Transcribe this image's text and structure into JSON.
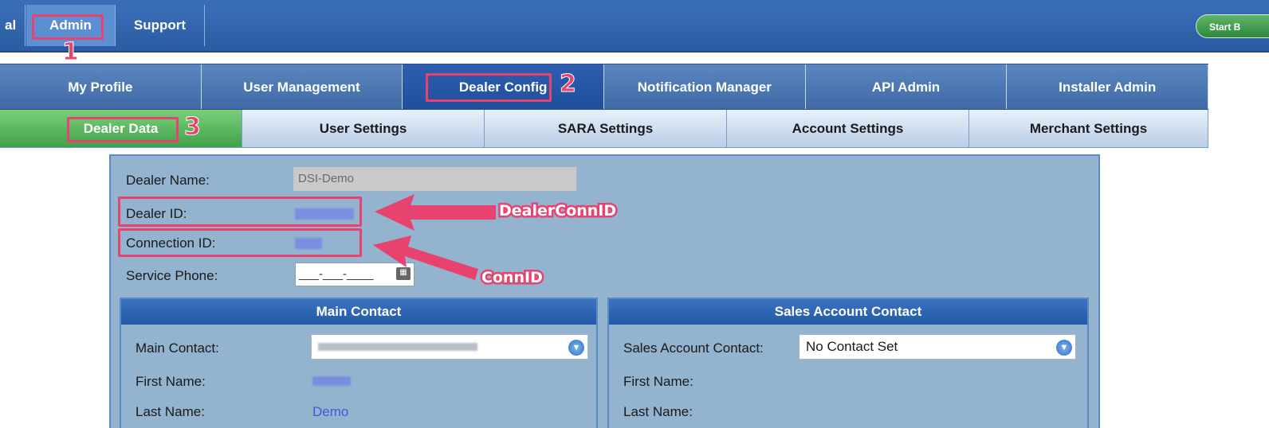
{
  "topnav": {
    "partial_label": "al",
    "admin_label": "Admin",
    "support_label": "Support",
    "start_button_label": "Start B"
  },
  "tabs_row1": [
    "My Profile",
    "User Management",
    "Dealer Config",
    "Notification Manager",
    "API Admin",
    "Installer Admin"
  ],
  "tabs_row1_active": "Dealer Config",
  "tabs_row2": [
    "Dealer Data",
    "User Settings",
    "SARA Settings",
    "Account Settings",
    "Merchant Settings"
  ],
  "tabs_row2_active": "Dealer Data",
  "form": {
    "dealer_name_label": "Dealer Name:",
    "dealer_name_value": "DSI-Demo",
    "dealer_id_label": "Dealer ID:",
    "connection_id_label": "Connection ID:",
    "service_phone_label": "Service Phone:",
    "service_phone_value": "___-___-____"
  },
  "main_contact": {
    "header": "Main Contact",
    "contact_label": "Main Contact:",
    "first_name_label": "First Name:",
    "last_name_label": "Last Name:",
    "last_name_value": "Demo"
  },
  "sales_contact": {
    "header": "Sales Account Contact",
    "contact_label": "Sales Account Contact:",
    "contact_value": "No Contact Set",
    "first_name_label": "First Name:",
    "last_name_label": "Last Name:"
  },
  "annotations": {
    "num1": "1",
    "num2": "2",
    "num3": "3",
    "callout_dealer": "DealerConnID",
    "callout_conn": "ConnID"
  },
  "colors": {
    "highlight": "#e8436f",
    "nav_blue": "#2b5ca3",
    "active_green": "#3ea24a"
  }
}
